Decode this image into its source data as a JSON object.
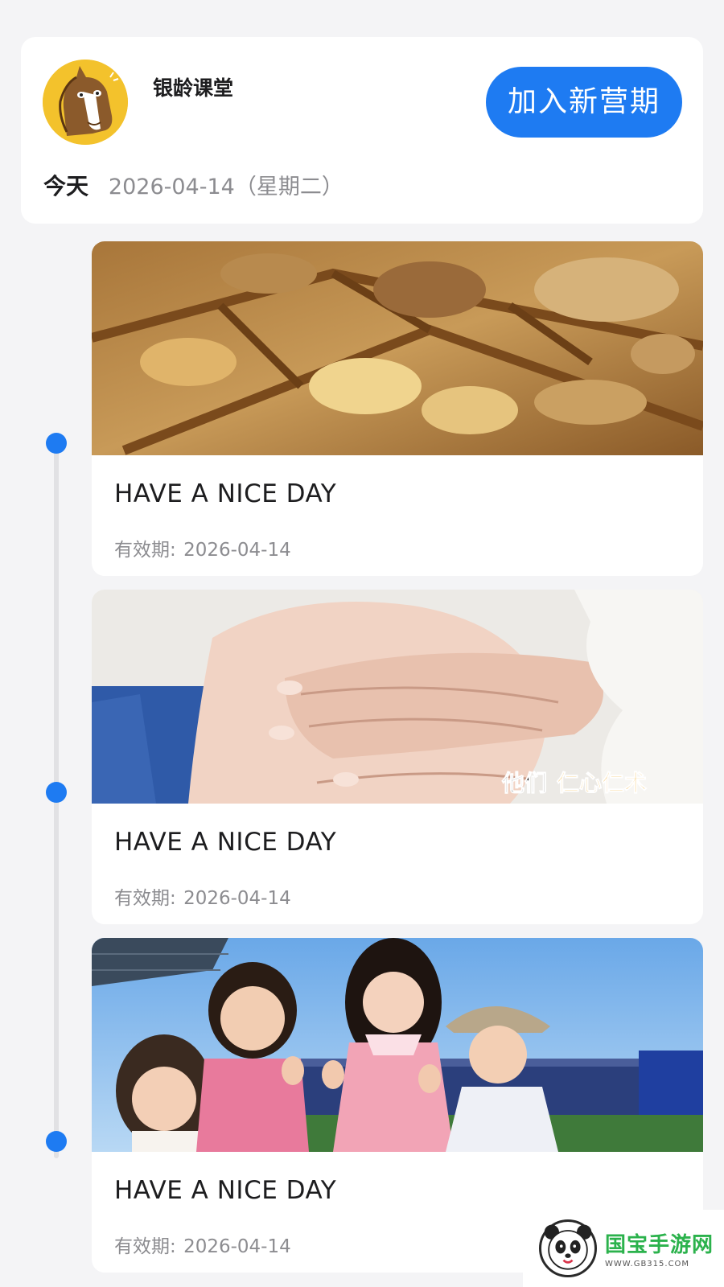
{
  "header": {
    "org_name": "银龄课堂",
    "join_button": "加入新营期",
    "today_label": "今天",
    "today_date": "2026-04-14（星期二）",
    "avatar_icon": "horse-avatar-icon"
  },
  "courses": [
    {
      "title": "HAVE A NICE DAY",
      "valid_label": "有效期:",
      "valid_date": "2026-04-14",
      "thumb": "herbal-medicine-tray"
    },
    {
      "title": "HAVE A NICE DAY",
      "valid_label": "有效期:",
      "valid_date": "2026-04-14",
      "thumb": "acupressure-hands",
      "caption_a": "他们",
      "caption_b": "仁心仁术"
    },
    {
      "title": "HAVE A NICE DAY",
      "valid_label": "有效期:",
      "valid_date": "2026-04-14",
      "thumb": "family-thumbs-up"
    }
  ],
  "watermark": {
    "brand": "国宝手游网",
    "url": "WWW.GB315.COM"
  },
  "colors": {
    "accent": "#1e7bf2",
    "background": "#f4f4f6",
    "muted_text": "#8c8c90",
    "caption_yellow": "#f0a81c"
  }
}
